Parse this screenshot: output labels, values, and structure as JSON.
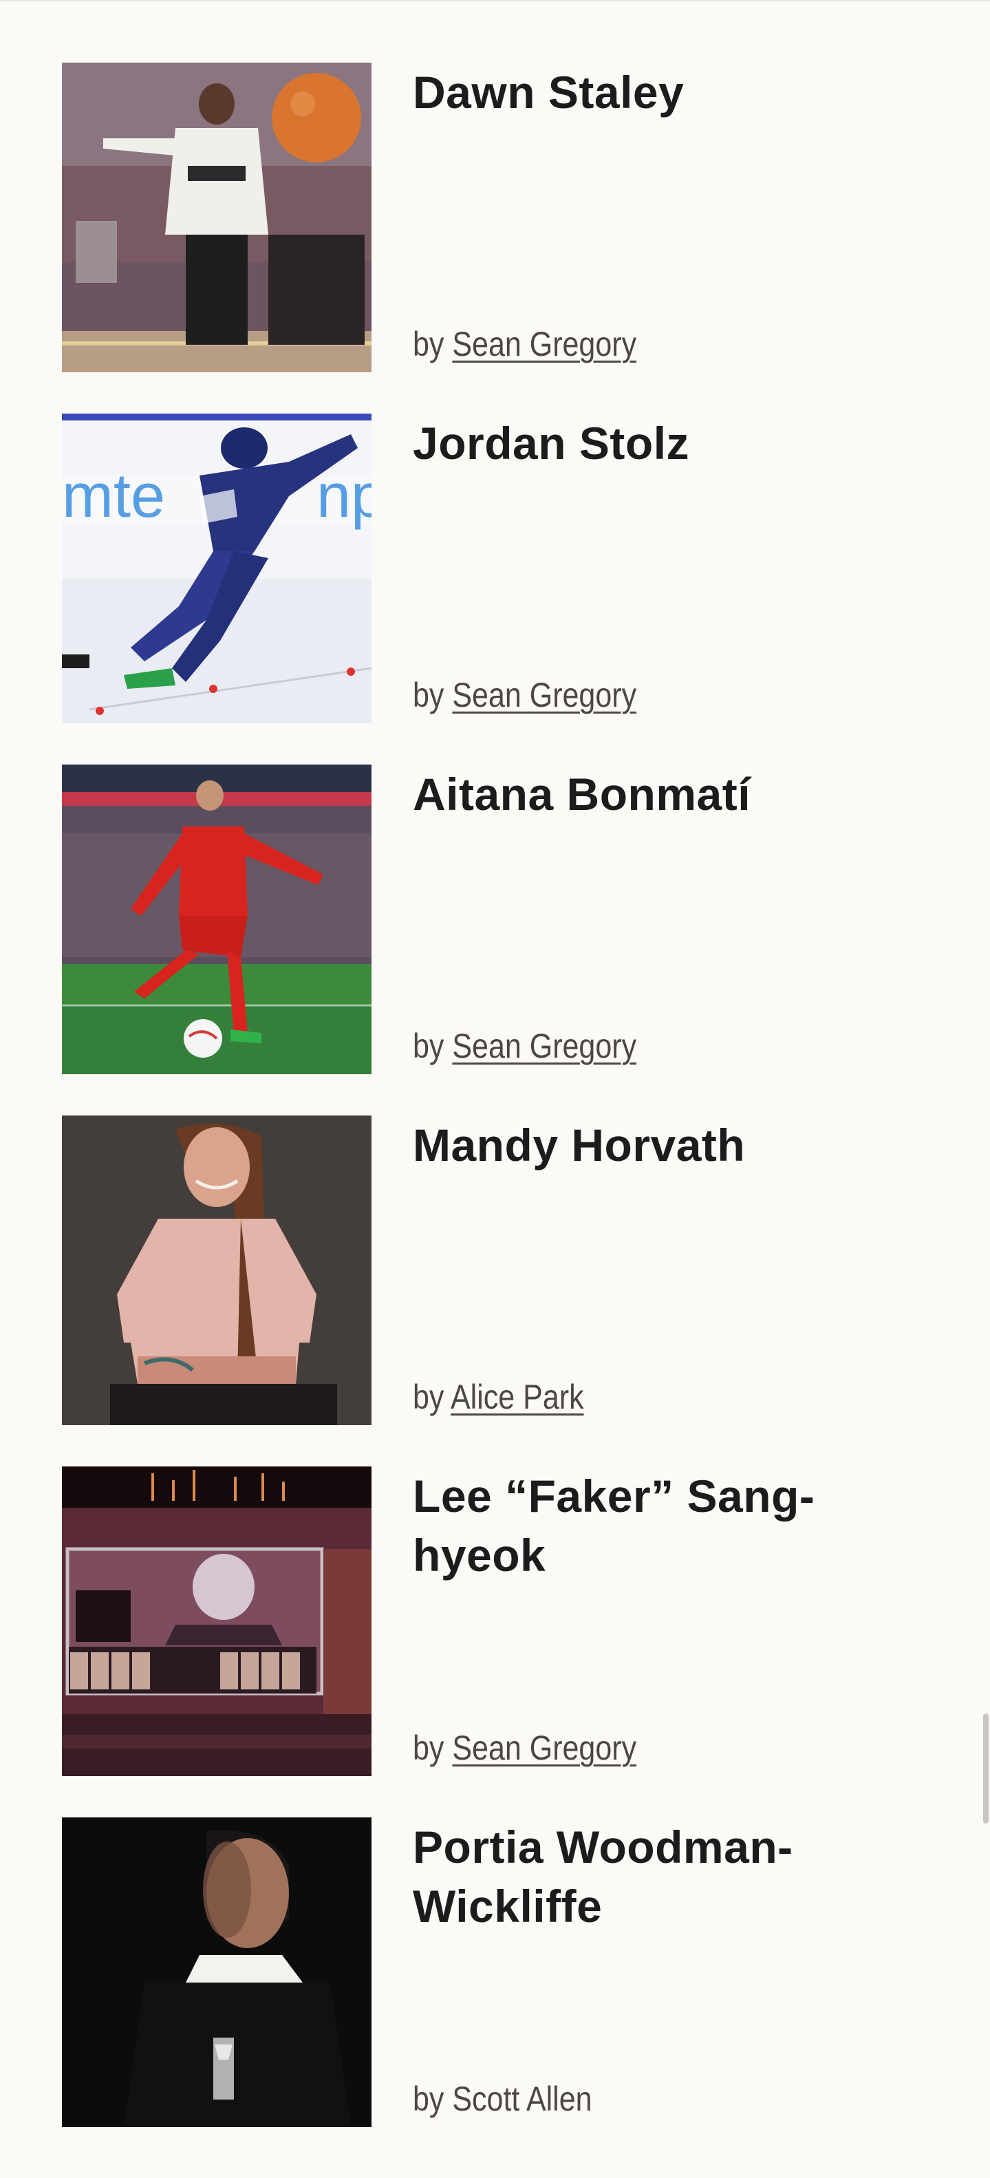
{
  "articles": [
    {
      "title": "Dawn Staley",
      "by": "by",
      "author": "Sean Gregory",
      "author_linked": true,
      "image": "basketball-coach-photo"
    },
    {
      "title": "Jordan Stolz",
      "by": "by",
      "author": "Sean Gregory",
      "author_linked": true,
      "image": "speed-skater-photo"
    },
    {
      "title": "Aitana Bonmatí",
      "by": "by",
      "author": "Sean Gregory",
      "author_linked": true,
      "image": "soccer-player-photo"
    },
    {
      "title": "Mandy Horvath",
      "by": "by",
      "author": "Alice Park",
      "author_linked": true,
      "image": "portrait-photo"
    },
    {
      "title": "Lee “Faker” Sang-hyeok",
      "by": "by",
      "author": "Sean Gregory",
      "author_linked": true,
      "image": "esports-arena-photo"
    },
    {
      "title": "Portia Woodman-Wickliffe",
      "by": "by",
      "author": "Scott Allen",
      "author_linked": false,
      "image": "rugby-player-portrait-photo"
    }
  ],
  "colors": {
    "background": "#fcfaf6",
    "title": "#1c1c1c",
    "byline": "#4a4744"
  }
}
